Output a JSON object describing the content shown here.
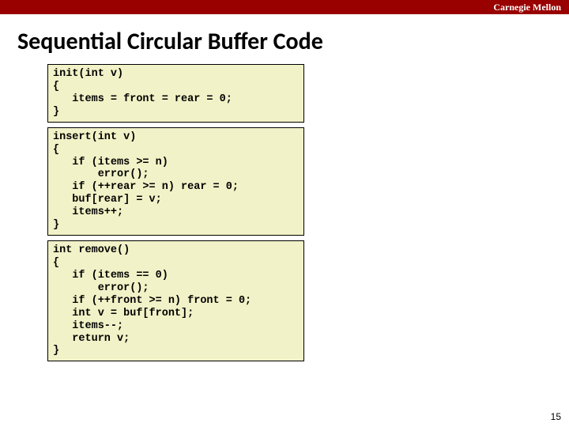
{
  "brand": "Carnegie Mellon",
  "title": "Sequential Circular Buffer Code",
  "code": {
    "init": "init(int v)\n{\n   items = front = rear = 0;\n}",
    "insert": "insert(int v)\n{\n   if (items >= n)\n       error();\n   if (++rear >= n) rear = 0;\n   buf[rear] = v;\n   items++;\n}",
    "remove": "int remove()\n{\n   if (items == 0)\n       error();\n   if (++front >= n) front = 0;\n   int v = buf[front];\n   items--;\n   return v;\n}"
  },
  "pageNumber": "15"
}
